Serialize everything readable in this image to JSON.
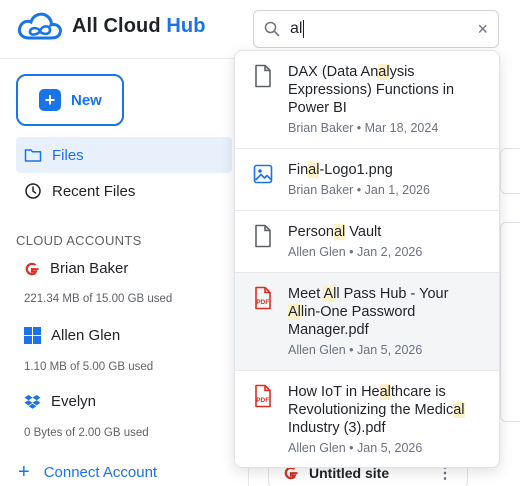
{
  "app": {
    "title_main": "All Cloud ",
    "title_accent": "Hub"
  },
  "search": {
    "query": "al",
    "clear_symbol": "×"
  },
  "sidebar": {
    "new_label": "New",
    "nav": [
      {
        "label": "Files",
        "icon": "folder-icon",
        "active": true
      },
      {
        "label": "Recent Files",
        "icon": "clock-icon",
        "active": false
      }
    ],
    "section_title": "CLOUD ACCOUNTS",
    "accounts": [
      {
        "name": "Brian Baker",
        "icon": "google-icon",
        "usage": "221.34 MB of 15.00 GB used"
      },
      {
        "name": "Allen Glen",
        "icon": "onedrive-windows-icon",
        "usage": "1.10 MB of 5.00 GB used"
      },
      {
        "name": "Evelyn",
        "icon": "dropbox-icon",
        "usage": "0 Bytes of 2.00 GB used"
      }
    ],
    "connect_label": "Connect Account"
  },
  "main": {
    "peek_card_title": "Untitled site",
    "peek_card_more": "⋮"
  },
  "results": [
    {
      "title_parts": [
        "DAX (Data An",
        "al",
        "ysis Expressions) Functions in Power BI"
      ],
      "meta": "Brian Baker • Mar 18, 2024",
      "icon": "document-icon"
    },
    {
      "title_parts": [
        "Fin",
        "al",
        "-Logo1.png"
      ],
      "meta": "Brian Baker • Jan 1, 2026",
      "icon": "image-icon"
    },
    {
      "title_parts": [
        "Person",
        "al",
        " Vault"
      ],
      "meta": "Allen Glen • Jan 2, 2026",
      "icon": "document-icon"
    },
    {
      "title_parts": [
        "Meet ",
        "Al",
        "l Pass Hub - Your ",
        "Al",
        "lin-One Password Manager.pdf"
      ],
      "meta": "Allen Glen • Jan 5, 2026",
      "icon": "pdf-icon"
    },
    {
      "title_parts": [
        "How IoT in He",
        "al",
        "thcare is Revolutionizing the Medic",
        "al",
        " Industry (3).pdf"
      ],
      "meta": "Allen Glen • Jan 5, 2026",
      "icon": "pdf-icon"
    }
  ],
  "colors": {
    "accent": "#1a73e8",
    "pdf": "#d93025",
    "highlight": "#fdf2c7"
  }
}
